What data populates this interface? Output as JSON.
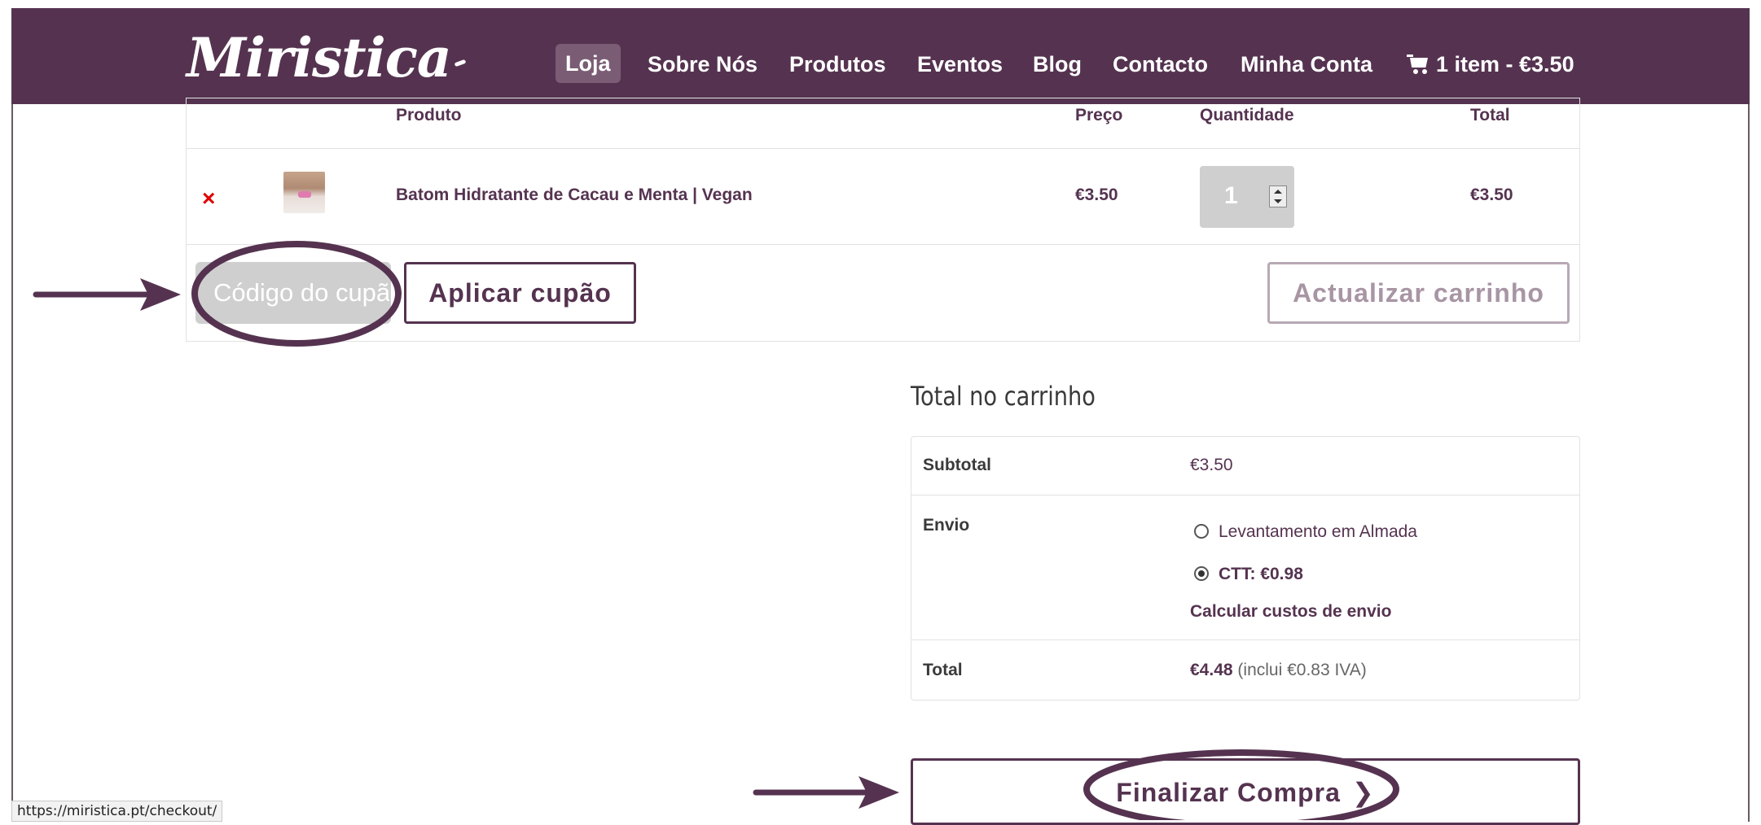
{
  "header": {
    "logo": "Miristica",
    "nav": [
      "Loja",
      "Sobre Nós",
      "Produtos",
      "Eventos",
      "Blog",
      "Contacto",
      "Minha Conta"
    ],
    "active_nav": "Loja",
    "cart_label": "1 item - €3.50"
  },
  "cart_table": {
    "headers": {
      "product": "Produto",
      "price": "Preço",
      "quantity": "Quantidade",
      "total": "Total"
    },
    "rows": [
      {
        "remove": "×",
        "product": "Batom Hidratante de Cacau e Menta | Vegan",
        "price": "€3.50",
        "quantity": "1",
        "total": "€3.50"
      }
    ]
  },
  "coupon": {
    "placeholder": "Código do cupão",
    "apply_label": "Aplicar cupão"
  },
  "update_cart_label": "Actualizar carrinho",
  "totals": {
    "title": "Total no carrinho",
    "subtotal_label": "Subtotal",
    "subtotal_value": "€3.50",
    "shipping_label": "Envio",
    "shipping_options": [
      {
        "label": "Levantamento em Almada",
        "selected": false
      },
      {
        "label": "CTT: €0.98",
        "selected": true
      }
    ],
    "calc_shipping": "Calcular custos de envio",
    "total_label": "Total",
    "total_value": "€4.48",
    "total_note": "(inclui €0.83 IVA)"
  },
  "checkout_label": "Finalizar Compra",
  "status_url": "https://miristica.pt/checkout/",
  "colors": {
    "brand": "#553350",
    "annotation": "#553350",
    "remove": "#e00000"
  }
}
